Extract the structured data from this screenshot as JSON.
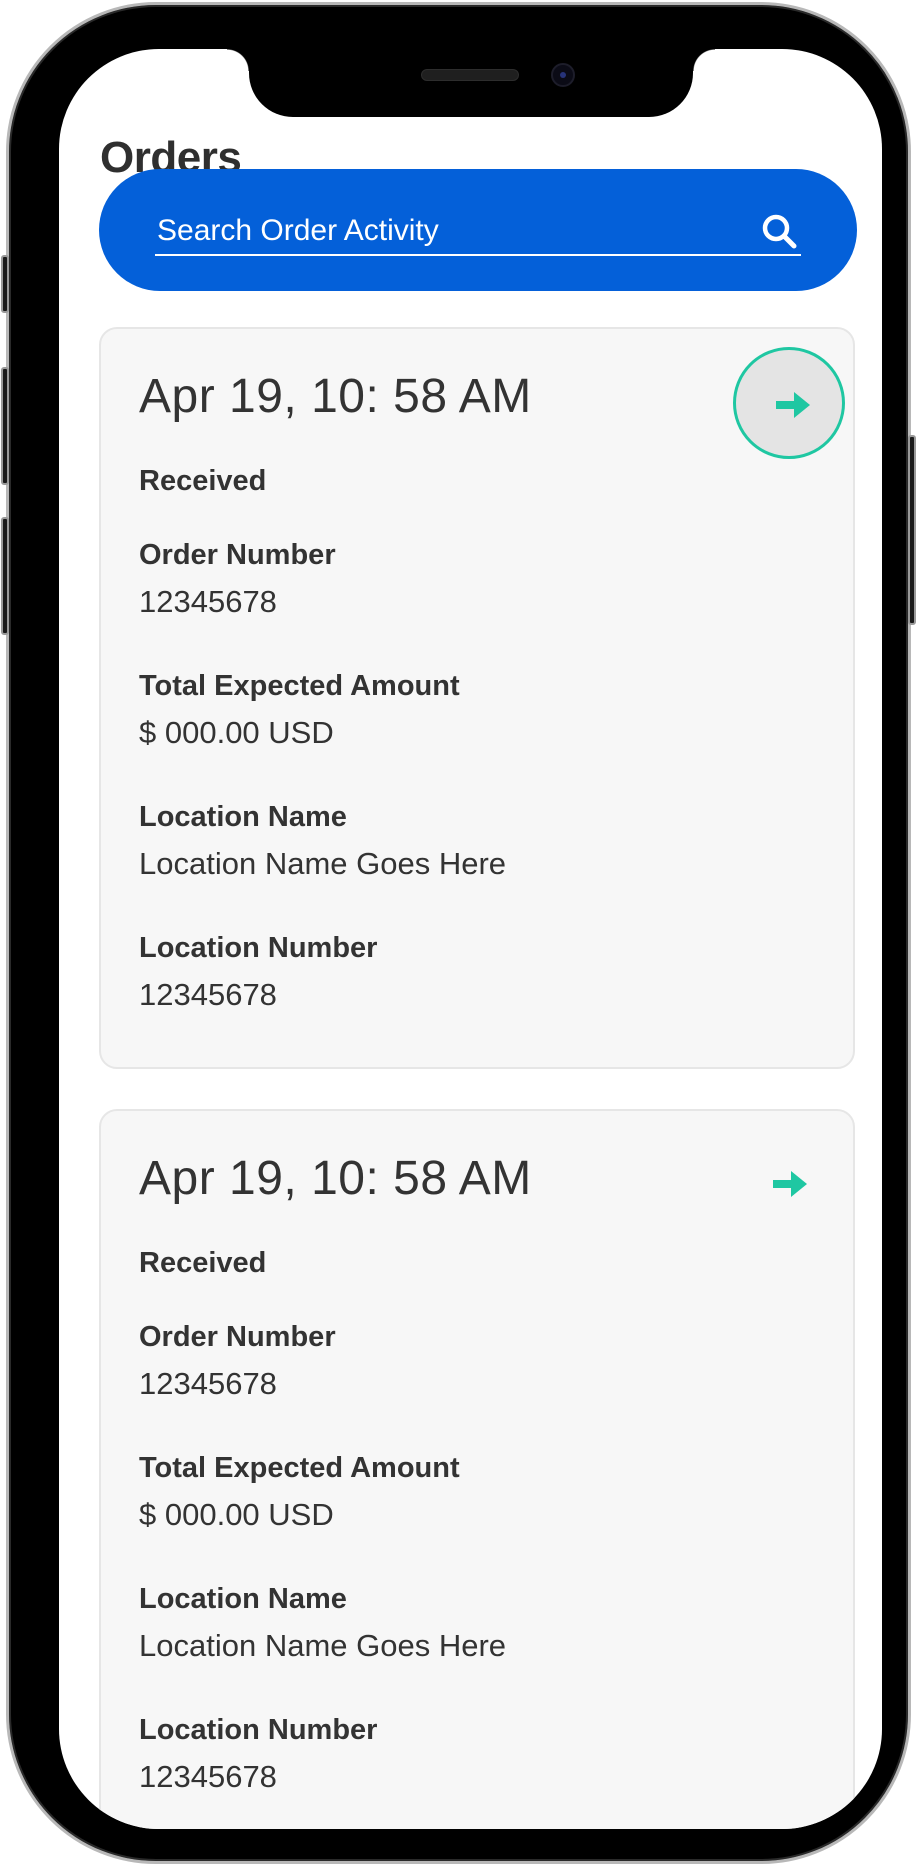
{
  "page": {
    "title": "Orders"
  },
  "search": {
    "placeholder": "Search Order Activity",
    "icon": "search-icon"
  },
  "colors": {
    "accent_blue": "#0460d9",
    "accent_teal": "#1fc7a2",
    "text": "#333333",
    "card_bg": "#f7f7f7"
  },
  "orders": [
    {
      "date": "Apr 19, 10: 58 AM",
      "status": "Received",
      "order_number_label": "Order Number",
      "order_number": "12345678",
      "amount_label": "Total Expected Amount",
      "amount": "$ 000.00 USD",
      "location_name_label": "Location Name",
      "location_name": "Location Name Goes Here",
      "location_number_label": "Location Number",
      "location_number": "12345678",
      "arrow_icon": "arrow-right-icon",
      "highlighted": true
    },
    {
      "date": "Apr 19, 10: 58 AM",
      "status": "Received",
      "order_number_label": "Order Number",
      "order_number": "12345678",
      "amount_label": "Total Expected Amount",
      "amount": "$ 000.00 USD",
      "location_name_label": "Location Name",
      "location_name": "Location Name Goes Here",
      "location_number_label": "Location Number",
      "location_number": "12345678",
      "arrow_icon": "arrow-right-icon",
      "highlighted": false
    }
  ]
}
